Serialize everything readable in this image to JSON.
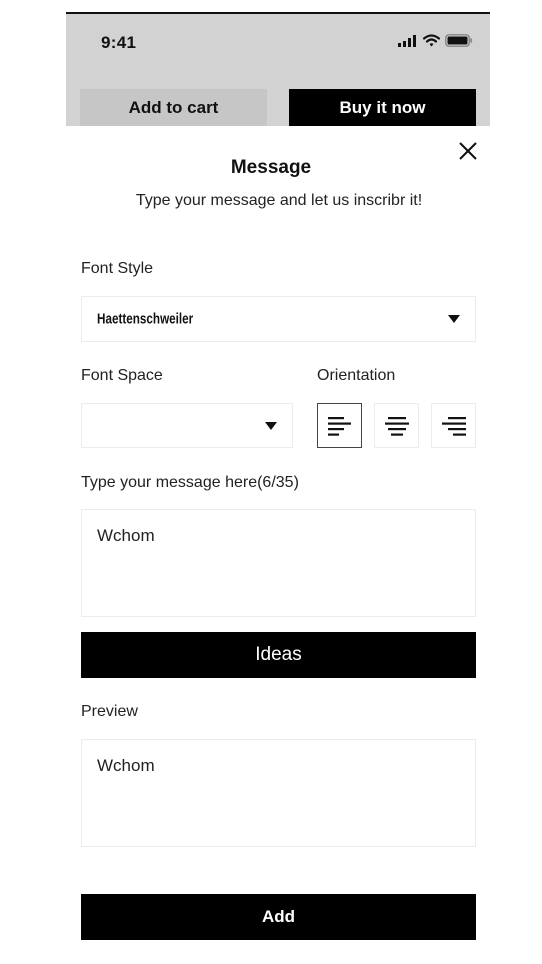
{
  "status_bar": {
    "time": "9:41",
    "icons": [
      "cellular-signal-icon",
      "wifi-icon",
      "battery-icon"
    ]
  },
  "background_actions": {
    "add_to_cart_label": "Add to cart",
    "buy_now_label": "Buy it now"
  },
  "modal": {
    "title": "Message",
    "subtitle": "Type your message and let us inscribr it!",
    "close_icon": "close-icon",
    "font_style": {
      "label": "Font Style",
      "selected": "Haettenschweiler"
    },
    "font_space": {
      "label": "Font Space",
      "selected": ""
    },
    "orientation": {
      "label": "Orientation",
      "options": [
        "align-left",
        "align-center",
        "align-right"
      ],
      "selected": "align-left"
    },
    "message": {
      "label": "Type your message here(6/35)",
      "value": "Wchom"
    },
    "ideas_label": "Ideas",
    "preview": {
      "label": "Preview",
      "text": "Wchom"
    },
    "add_label": "Add"
  }
}
